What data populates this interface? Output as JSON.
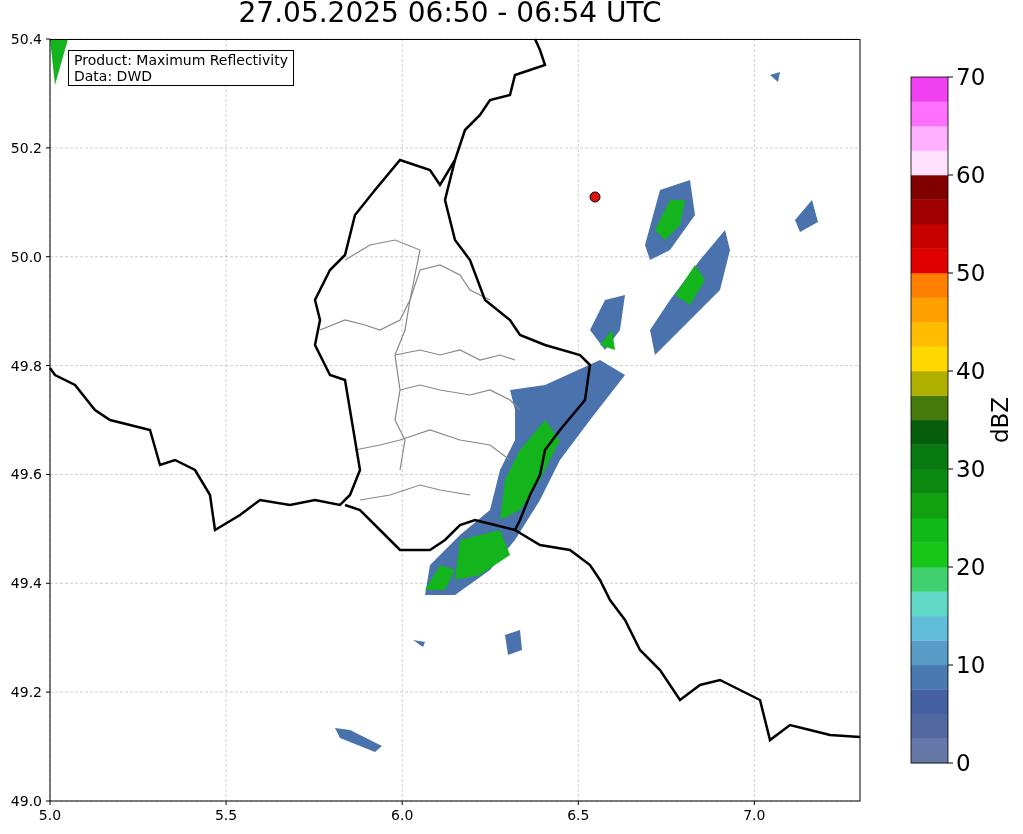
{
  "title": "27.05.2025 06:50 - 06:54 UTC",
  "map": {
    "annotation": [
      "Product: Maximum Reflectivity",
      "Data: DWD"
    ],
    "xticks": [
      "5.0",
      "5.5",
      "6.0",
      "6.5",
      "7.0"
    ],
    "yticks": [
      "50.4",
      "50.2",
      "50.0",
      "49.8",
      "49.6",
      "49.4",
      "49.2",
      "49.0"
    ]
  },
  "colorbar": {
    "label": "dBZ",
    "ticks": [
      "70",
      "60",
      "50",
      "40",
      "30",
      "20",
      "10",
      "0"
    ],
    "bands": [
      {
        "color": "#6578a8"
      },
      {
        "color": "#5468a0"
      },
      {
        "color": "#4560a0"
      },
      {
        "color": "#4a78b0"
      },
      {
        "color": "#5a9cc8"
      },
      {
        "color": "#60bcd8"
      },
      {
        "color": "#60d8c8"
      },
      {
        "color": "#40d070"
      },
      {
        "color": "#18c818"
      },
      {
        "color": "#10b818"
      },
      {
        "color": "#10a010"
      },
      {
        "color": "#0a8a10"
      },
      {
        "color": "#087810"
      },
      {
        "color": "#065e0c"
      },
      {
        "color": "#467a0a"
      },
      {
        "color": "#b0b000"
      },
      {
        "color": "#ffd800"
      },
      {
        "color": "#ffbc00"
      },
      {
        "color": "#ffa000"
      },
      {
        "color": "#ff8000"
      },
      {
        "color": "#e00000"
      },
      {
        "color": "#c80000"
      },
      {
        "color": "#a00000"
      },
      {
        "color": "#800000"
      },
      {
        "color": "#ffe0ff"
      },
      {
        "color": "#ffb0ff"
      },
      {
        "color": "#ff70ff"
      },
      {
        "color": "#f040f0"
      }
    ]
  }
}
